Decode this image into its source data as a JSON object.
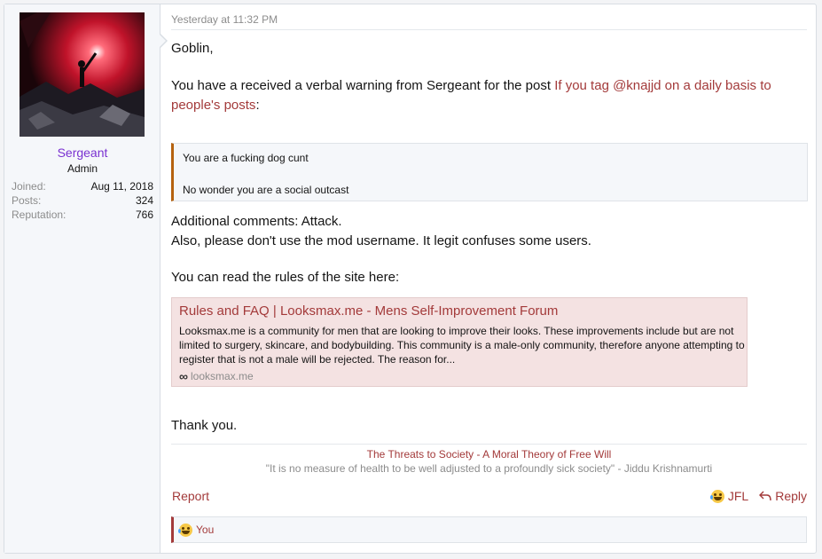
{
  "user": {
    "name": "Sergeant",
    "title": "Admin",
    "stats": [
      {
        "label": "Joined:",
        "value": "Aug 11, 2018"
      },
      {
        "label": "Posts:",
        "value": "324"
      },
      {
        "label": "Reputation:",
        "value": "766"
      }
    ]
  },
  "post": {
    "date": "Yesterday at 11:32 PM",
    "greeting": "Goblin,",
    "warning_prefix": "You have a received a verbal warning from Sergeant for the post ",
    "warning_link": "If you tag @knajjd on a daily basis to people's posts",
    "warning_suffix": ":",
    "quote_lines": [
      "You are a fucking dog cunt",
      "No wonder you are a social outcast"
    ],
    "comments_line1": "Additional comments: Attack.",
    "comments_line2": "Also, please don't use the mod username. It legit confuses some users.",
    "rules_line": "You can read the rules of the site here:",
    "embed": {
      "title": "Rules and FAQ | Looksmax.me - Mens Self-Improvement Forum",
      "description": "Looksmax.me is a community for men that are looking to improve their looks. These improvements include but are not limited to surgery, skincare, and bodybuilding. This community is a male-only community, therefore anyone attempting to register that is not a male will be rejected. The reason for...",
      "domain": "looksmax.me",
      "domain_icon": "∞"
    },
    "closing": "Thank you."
  },
  "signature": {
    "link": "The Threats to Society - A Moral Theory of Free Will",
    "quote": "\"It is no measure of health to be well adjusted to a profoundly sick society\" - Jiddu Krishnamurti"
  },
  "actions": {
    "report": "Report",
    "jfl": "JFL",
    "reply": "Reply"
  },
  "reactions": {
    "who": "You"
  },
  "colors": {
    "accent": "#a33a3a",
    "username": "#7a31d1",
    "quote_border": "#b5620f",
    "embed_bg": "#f4e2e2"
  }
}
